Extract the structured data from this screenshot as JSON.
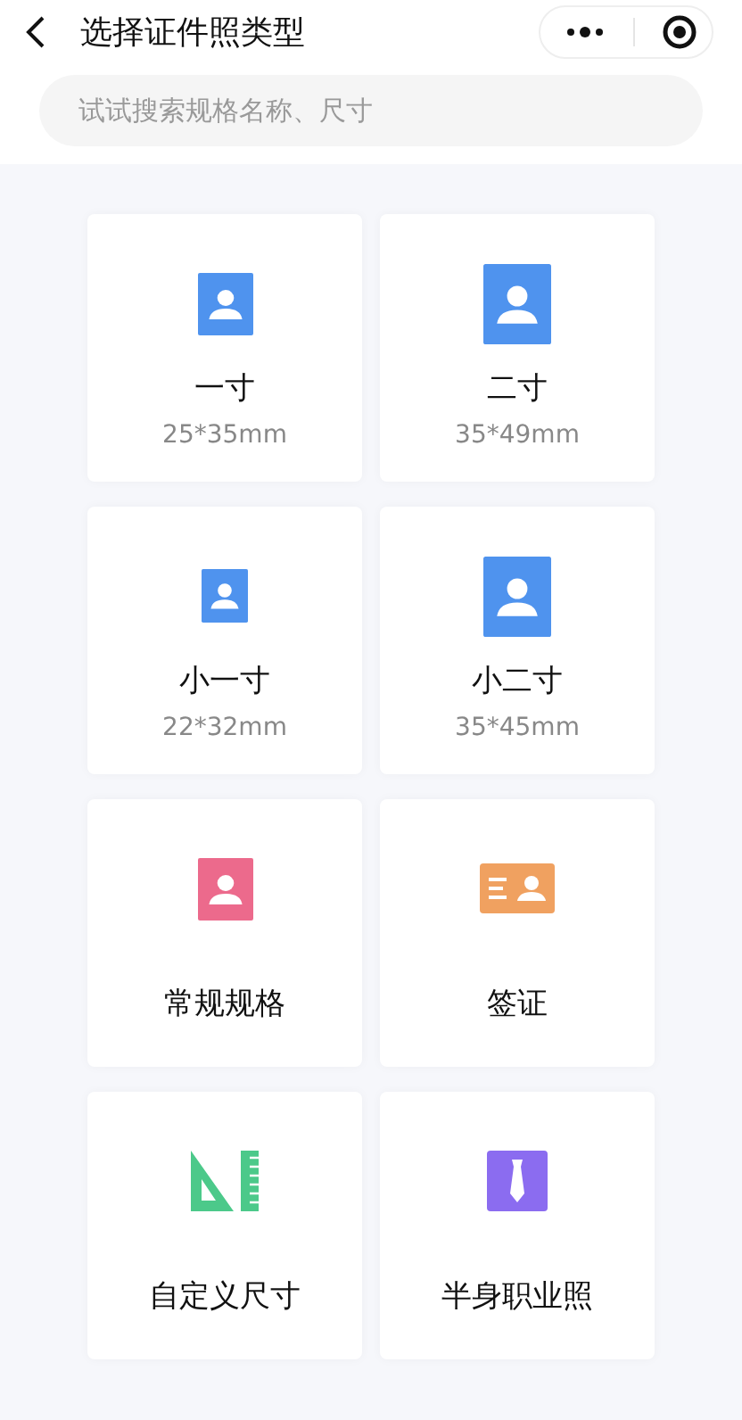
{
  "header": {
    "title": "选择证件照类型"
  },
  "search": {
    "placeholder": "试试搜索规格名称、尺寸"
  },
  "cards": [
    {
      "kind": "portrait",
      "color": "#4f93ee",
      "label": "一寸",
      "dimensions": "25*35mm"
    },
    {
      "kind": "largeportrait",
      "color": "#4f93ee",
      "label": "二寸",
      "dimensions": "35*49mm"
    },
    {
      "kind": "smallportrait",
      "color": "#4f93ee",
      "label": "小一寸",
      "dimensions": "22*32mm"
    },
    {
      "kind": "largeportrait",
      "color": "#4f93ee",
      "label": "小二寸",
      "dimensions": "35*45mm"
    },
    {
      "kind": "portrait",
      "color": "#ec6a8c",
      "label": "常规规格"
    },
    {
      "kind": "visa",
      "label": "签证"
    },
    {
      "kind": "ruler",
      "label": "自定义尺寸"
    },
    {
      "kind": "tie",
      "label": "半身职业照"
    }
  ]
}
